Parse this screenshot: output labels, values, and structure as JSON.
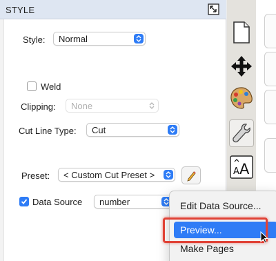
{
  "panel": {
    "title": "STYLE",
    "style_label": "Style:",
    "style_value": "Normal",
    "weld_label": "Weld",
    "clipping_label": "Clipping:",
    "clipping_value": "None",
    "cut_line_type_label": "Cut Line Type:",
    "cut_line_type_value": "Cut",
    "preset_label": "Preset:",
    "preset_value": "< Custom Cut Preset >",
    "data_source_label": "Data Source",
    "data_source_checked": true,
    "weld_checked": false,
    "data_source_value": "number"
  },
  "tools": {
    "icons": [
      "page-icon",
      "move-icon",
      "palette-icon",
      "wrench-icon",
      "text-style-icon"
    ],
    "active": "wrench-icon"
  },
  "context_menu": {
    "items": [
      "Edit Data Source...",
      "Preview...",
      "Make Pages"
    ],
    "highlighted": "Preview..."
  },
  "colors": {
    "accent": "#2e7cf6",
    "header": "#dee6f2",
    "callout": "#e04236"
  }
}
